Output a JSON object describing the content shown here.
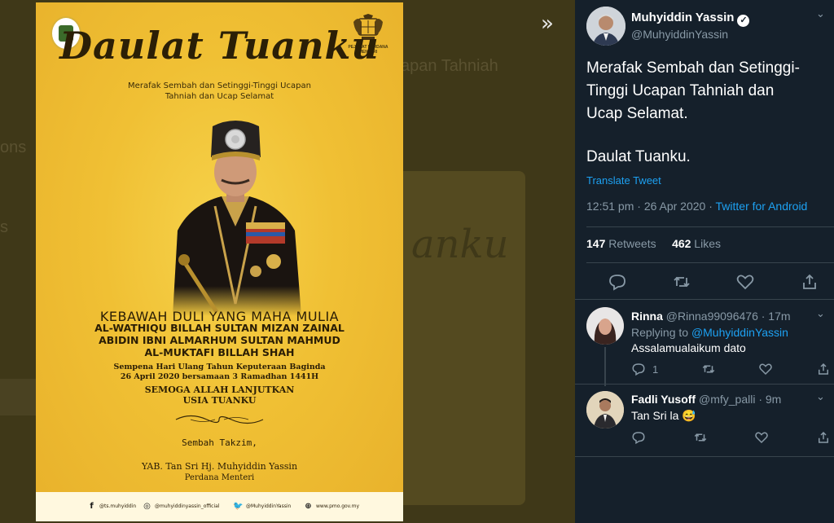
{
  "backdrop": {
    "fragment_1": "apan Tahniah",
    "fragment_2": "ons",
    "fragment_3": "s",
    "card_script": "anku",
    "expand_glyph": "»"
  },
  "poster": {
    "emblem_right_label": "PEJABAT PERDANA MENTERI",
    "title": "Daulat Tuanku",
    "subtitle_line1": "Merafak Sembah dan Setinggi-Tinggi Ucapan",
    "subtitle_line2": "Tahniah dan Ucap Selamat",
    "honorific": "KEBAWAH DULI YANG MAHA MULIA",
    "name_line1": "AL-WATHIQU BILLAH SULTAN MIZAN ZAINAL",
    "name_line2": "ABIDIN IBNI ALMARHUM SULTAN MAHMUD",
    "name_line3": "AL-MUKTAFI BILLAH SHAH",
    "occasion_line1": "Sempena Hari Ulang Tahun Keputeraan Baginda",
    "occasion_line2": "26 April 2020  bersamaan 3 Ramadhan 1441H",
    "prayer_line1": "SEMOGA ALLAH LANJUTKAN",
    "prayer_line2": "USIA TUANKU",
    "closing": "Sembah Takzim,",
    "signatory": "YAB. Tan Sri Hj. Muhyiddin Yassin",
    "signatory_title": "Perdana Menteri",
    "social": [
      {
        "icon": "facebook-icon",
        "glyph": "f",
        "label": "@ts.muhyiddin"
      },
      {
        "icon": "instagram-icon",
        "glyph": "◎",
        "label": "@muhyiddinyassin_official"
      },
      {
        "icon": "twitter-icon",
        "glyph": "🐦",
        "label": "@MuhyiddinYassin"
      },
      {
        "icon": "web-icon",
        "glyph": "⊕",
        "label": "www.pmo.gov.my"
      }
    ]
  },
  "tweet": {
    "author_name": "Muhyiddin Yassin",
    "author_handle": "@MuhyiddinYassin",
    "text_line1": "Merafak Sembah dan Setinggi-",
    "text_line2": "Tinggi Ucapan Tahniah dan",
    "text_line3": "Ucap Selamat.",
    "text_line4": "Daulat Tuanku.",
    "translate_label": "Translate Tweet",
    "time": "12:51 pm · 26 Apr 2020 · ",
    "app": "Twitter for Android",
    "retweets_count": "147",
    "retweets_label": " Retweets",
    "likes_count": "462",
    "likes_label": " Likes"
  },
  "replies": [
    {
      "name": "Rinna",
      "handle": "@Rinna99096476 · 17m",
      "replying_prefix": "Replying to ",
      "replying_to": "@MuhyiddinYassin",
      "text": "Assalamualaikum dato",
      "reply_count": "1"
    },
    {
      "name": "Fadli Yusoff",
      "handle": "@mfy_palli · 9m",
      "text": "Tan Sri la 😅"
    }
  ],
  "colors": {
    "panel_bg": "#15202b",
    "accent": "#1da1f2",
    "muted": "#8899a6",
    "poster_gold": "#f0c034"
  }
}
